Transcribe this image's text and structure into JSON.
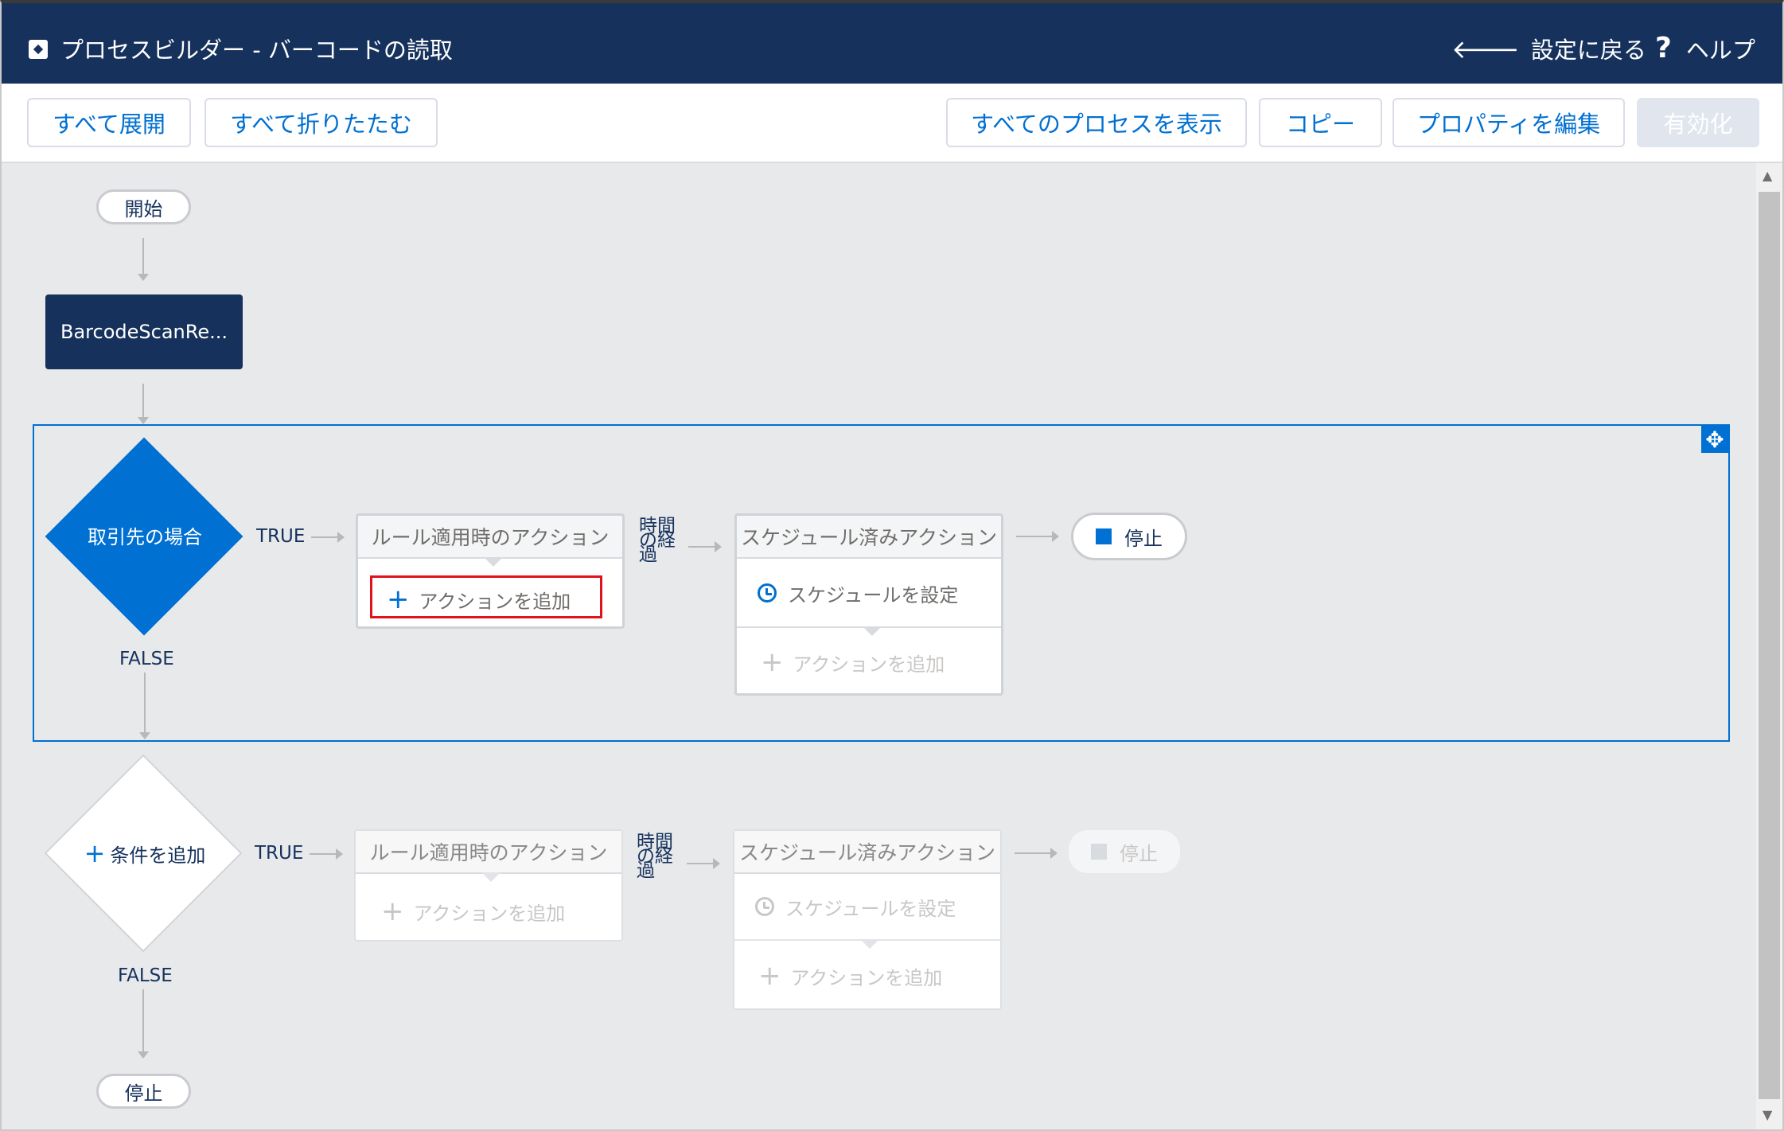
{
  "header": {
    "title": "プロセスビルダー - バーコードの読取",
    "back_label": "設定に戻る",
    "help_label": "ヘルプ",
    "help_icon_glyph": "?",
    "back_icon_glyph": "🡐"
  },
  "toolbar": {
    "expand_all": "すべて展開",
    "collapse_all": "すべて折りたたむ",
    "view_all_processes": "すべてのプロセスを表示",
    "copy": "コピー",
    "edit_properties": "プロパティを編集",
    "activate": "有効化"
  },
  "flow": {
    "start_label": "開始",
    "object_node_label": "BarcodeScanRe...",
    "criteria_1": {
      "label": "取引先の場合",
      "true_label": "TRUE",
      "false_label": "FALSE",
      "immediate_header": "ルール適用時のアクション",
      "immediate_add_action": "アクションを追加",
      "time_label": "時間の経過",
      "scheduled_header": "スケジュール済みアクション",
      "set_schedule": "スケジュールを設定",
      "scheduled_add_action": "アクションを追加",
      "stop_label": "停止"
    },
    "criteria_2": {
      "label": "条件を追加",
      "true_label": "TRUE",
      "false_label": "FALSE",
      "immediate_header": "ルール適用時のアクション",
      "immediate_add_action": "アクションを追加",
      "time_label": "時間の経過",
      "scheduled_header": "スケジュール済みアクション",
      "set_schedule": "スケジュールを設定",
      "scheduled_add_action": "アクションを追加",
      "stop_label": "停止"
    },
    "end_label": "停止"
  },
  "icons": {
    "app": "process-builder-icon",
    "move": "move-icon",
    "plus": "+",
    "move_glyph": "✥"
  },
  "colors": {
    "header_bg": "#16325c",
    "brand_blue": "#0070d2",
    "highlight": "#e0131d"
  }
}
